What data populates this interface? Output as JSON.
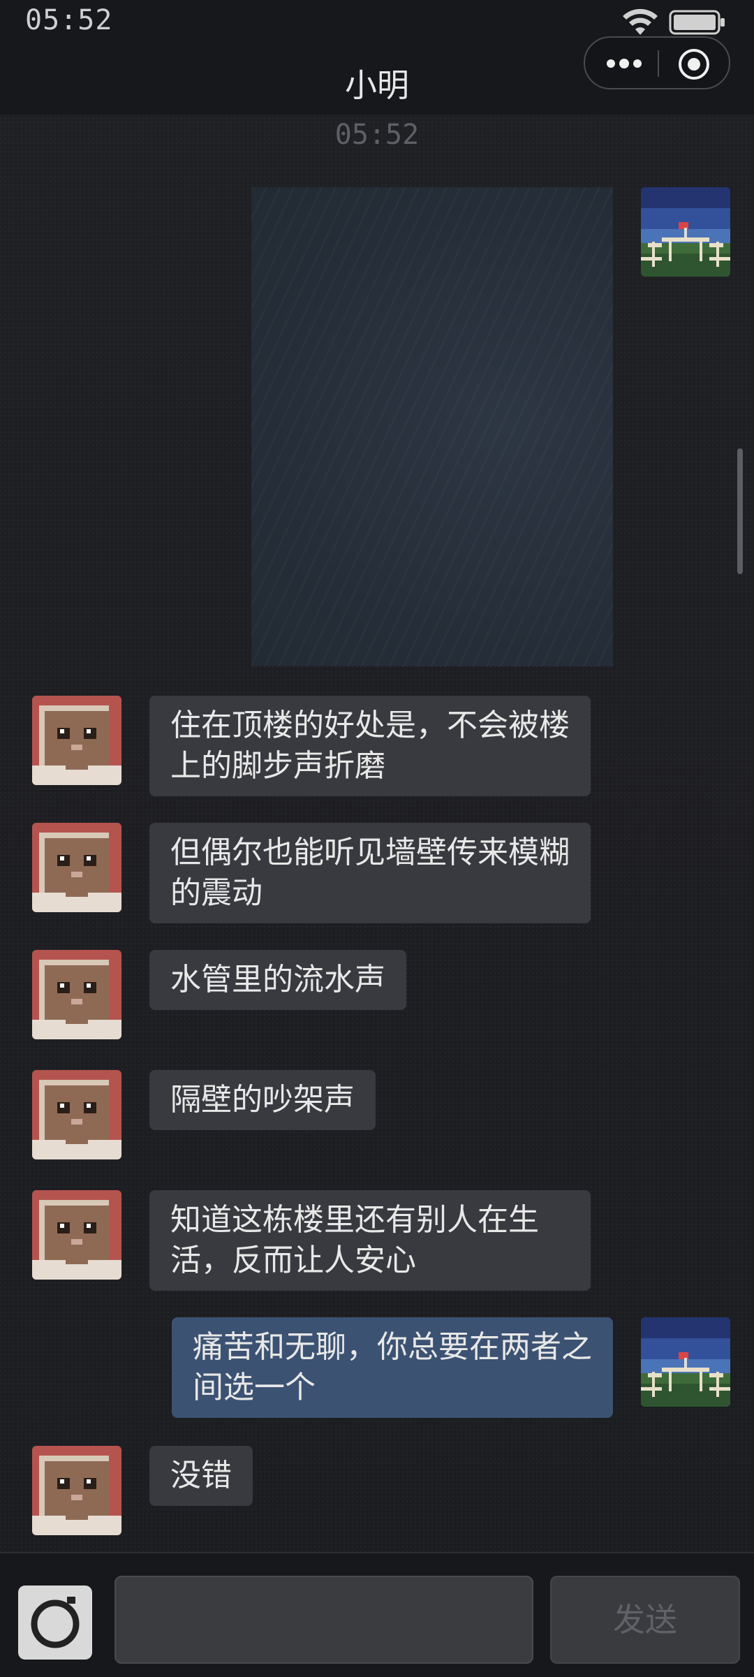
{
  "status_bar": {
    "time": "05:52",
    "wifi_icon": "wifi-icon",
    "battery_icon": "battery-icon"
  },
  "nav": {
    "title": "小明",
    "more_icon": "more-dots-icon",
    "close_icon": "target-circle-icon"
  },
  "chat": {
    "timestamp": "05:52",
    "messages": [
      {
        "from": "self",
        "type": "image"
      },
      {
        "from": "other",
        "type": "text",
        "text": "住在顶楼的好处是，不会被楼上的脚步声折磨"
      },
      {
        "from": "other",
        "type": "text",
        "text": "但偶尔也能听见墙壁传来模糊的震动"
      },
      {
        "from": "other",
        "type": "text",
        "text": "水管里的流水声"
      },
      {
        "from": "other",
        "type": "text",
        "text": "隔壁的吵架声"
      },
      {
        "from": "other",
        "type": "text",
        "text": "知道这栋楼里还有别人在生活，反而让人安心"
      },
      {
        "from": "self",
        "type": "text",
        "text": "痛苦和无聊，你总要在两者之间选一个"
      },
      {
        "from": "other",
        "type": "text",
        "text": "没错"
      }
    ]
  },
  "input_bar": {
    "camera_icon": "camera-icon",
    "input_value": "",
    "send_label": "发送"
  },
  "colors": {
    "self_bubble": "#3c5272",
    "other_bubble": "#393a3f",
    "background": "#1e1f23"
  }
}
